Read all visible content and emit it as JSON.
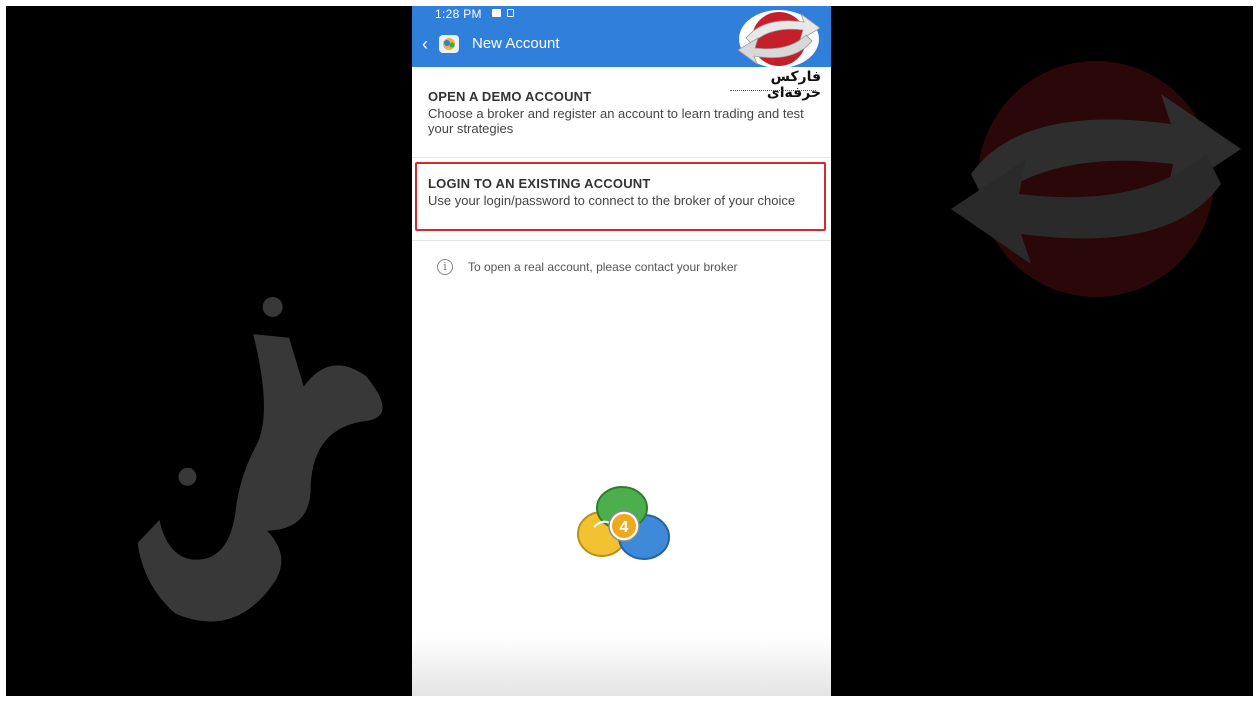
{
  "status_bar": {
    "time": "1:28 PM"
  },
  "app_bar": {
    "title": "New Account"
  },
  "brand": {
    "name": "فارکس حرفه‌ای"
  },
  "options": [
    {
      "title": "OPEN A DEMO ACCOUNT",
      "description": "Choose a broker and register an account to learn trading and test your strategies"
    },
    {
      "title": "LOGIN TO AN EXISTING ACCOUNT",
      "description": "Use your login/password to connect to the broker of your choice"
    }
  ],
  "info": {
    "text": "To open a real account, please contact your broker"
  },
  "icons": {
    "back": "chevron-left-icon",
    "info": "info-icon",
    "app": "mt4-app-icon"
  },
  "colors": {
    "app_bar": "#2f7fdb",
    "highlight": "#d9272e",
    "background": "#000000"
  }
}
